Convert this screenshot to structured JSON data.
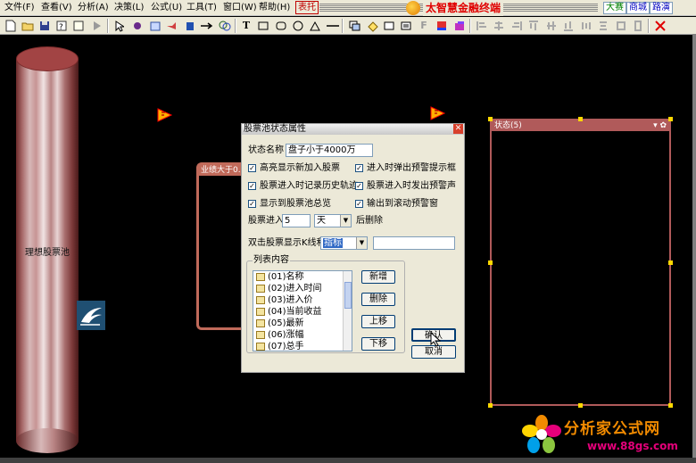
{
  "menu": {
    "items": [
      "文件(F)",
      "查看(V)",
      "分析(A)",
      "决策(L)",
      "公式(U)",
      "工具(T)",
      "窗口(W)",
      "帮助(H)"
    ],
    "highlight": "表托",
    "app_title": "太智慧金融终端",
    "right_buttons": [
      "大赛",
      "商城",
      "路演"
    ]
  },
  "toolbar": {
    "icons": [
      "new-file-icon",
      "open-folder-icon",
      "save-icon",
      "print-setup-icon",
      "help-icon",
      "play-icon",
      "pointer-icon",
      "record-icon",
      "form-icon",
      "pipe-icon",
      "delete-icon",
      "arrow-right-icon",
      "link-icon",
      "text-tool-icon",
      "rectangle-tool-icon",
      "rounded-rect-tool-icon",
      "circle-tool-icon",
      "triangle-tool-icon",
      "line-tool-icon",
      "layer-icon",
      "fill-icon",
      "frame-icon",
      "frame2-icon",
      "font-icon",
      "color-icon",
      "align-left-icon",
      "align-center-icon",
      "align-right-icon",
      "align-top-icon",
      "align-middle-icon",
      "align-bottom-icon",
      "distribute-h-icon",
      "distribute-v-icon",
      "same-width-icon",
      "same-height-icon",
      "close-x-icon"
    ],
    "text_glyph": "T",
    "font_glyph": "F"
  },
  "canvas": {
    "pool_label": "理想股票池",
    "filter_label": "业绩大于0.",
    "state_box_title": "状态(5)",
    "state_box_icons": "▾ ✿"
  },
  "dialog": {
    "title": "股票池状态属性",
    "close_glyph": "✕",
    "name_label": "状态名称",
    "name_value": "盘子小于4000万",
    "checks": [
      {
        "label": "高亮显示新加入股票",
        "checked": true
      },
      {
        "label": "进入时弹出预警提示框",
        "checked": true
      },
      {
        "label": "股票进入时记录历史轨迹",
        "checked": true
      },
      {
        "label": "股票进入时发出预警声",
        "checked": true
      },
      {
        "label": "显示到股票池总览",
        "checked": true
      },
      {
        "label": "输出到滚动预警窗",
        "checked": true
      }
    ],
    "check_glyph": "✓",
    "delete_prefix": "股票进入",
    "days_value": "5",
    "days_unit": "天",
    "delete_suffix": "后删除",
    "double_click_label": "双击股票显示K线和",
    "indicator_value": "指标",
    "indicator_extra": "",
    "list_group_label": "列表内容",
    "list_items": [
      "(01)名称",
      "(02)进入时间",
      "(03)进入价",
      "(04)当前收益",
      "(05)最新",
      "(06)涨幅",
      "(07)总手"
    ],
    "btn_add": "新增",
    "btn_delete": "删除",
    "btn_up": "上移",
    "btn_down": "下移",
    "btn_ok": "确认",
    "btn_cancel": "取消"
  },
  "watermark": {
    "title": "分析家公式网",
    "url": "www.88gs.com"
  },
  "colors": {
    "canvas_bg": "#000000",
    "pool_cylinder": "#a24444",
    "frame_border": "#c06a5a",
    "selection_handle": "#ffd800",
    "title_red": "#e00000",
    "watermark_orange": "#f28b00",
    "watermark_pink": "#e5007a"
  }
}
